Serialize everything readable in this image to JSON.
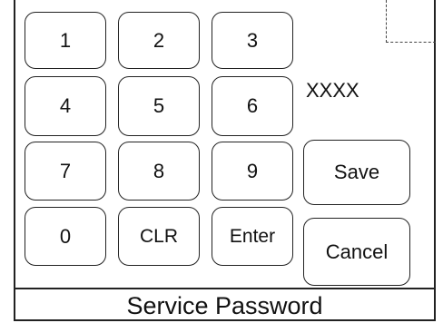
{
  "keypad": {
    "keys": [
      {
        "label": "1"
      },
      {
        "label": "2"
      },
      {
        "label": "3"
      },
      {
        "label": "4"
      },
      {
        "label": "5"
      },
      {
        "label": "6"
      },
      {
        "label": "7"
      },
      {
        "label": "8"
      },
      {
        "label": "9"
      },
      {
        "label": "0"
      },
      {
        "label": "CLR"
      },
      {
        "label": "Enter"
      }
    ]
  },
  "display": {
    "value": "XXXX"
  },
  "actions": {
    "save_label": "Save",
    "cancel_label": "Cancel"
  },
  "footer": {
    "title": "Service Password"
  }
}
